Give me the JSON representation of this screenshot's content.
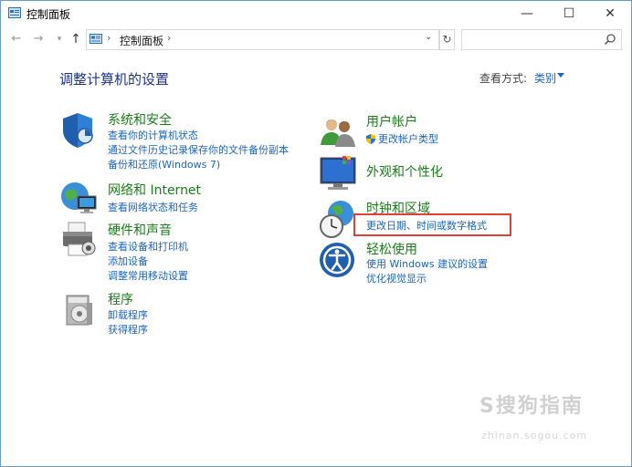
{
  "window": {
    "title": "控制面板"
  },
  "window_controls": {
    "minimize": "—",
    "maximize": "☐",
    "close": "✕"
  },
  "nav": {
    "back": "←",
    "forward": "→",
    "up": "↑",
    "address_sep": "›",
    "address_text": "控制面板",
    "address_sep2": "›"
  },
  "search": {
    "placeholder": ""
  },
  "header": {
    "title": "调整计算机的设置",
    "view_label": "查看方式:",
    "view_value": "类别"
  },
  "categories": [
    {
      "title": "系统和安全",
      "links": [
        "查看你的计算机状态",
        "通过文件历史记录保存你的文件备份副本",
        "备份和还原(Windows 7)"
      ]
    },
    {
      "title": "网络和 Internet",
      "links": [
        "查看网络状态和任务"
      ]
    },
    {
      "title": "硬件和声音",
      "links": [
        "查看设备和打印机",
        "添加设备",
        "调整常用移动设置"
      ]
    },
    {
      "title": "程序",
      "links": [
        "卸载程序",
        "获得程序"
      ]
    },
    {
      "title": "用户帐户",
      "links": [
        "更改帐户类型"
      ]
    },
    {
      "title": "外观和个性化",
      "links": []
    },
    {
      "title": "时钟和区域",
      "links": [
        "更改日期、时间或数字格式"
      ]
    },
    {
      "title": "轻松使用",
      "links": [
        "使用 Windows 建议的设置",
        "优化视觉显示"
      ]
    }
  ],
  "watermark": {
    "text": "S搜狗指南",
    "url": "zhinan.sogou.com"
  },
  "colors": {
    "title_green": "#1a7d1a",
    "link_blue": "#1a65c2",
    "heading_blue": "#1e3287",
    "highlight_red": "#e0403a"
  }
}
